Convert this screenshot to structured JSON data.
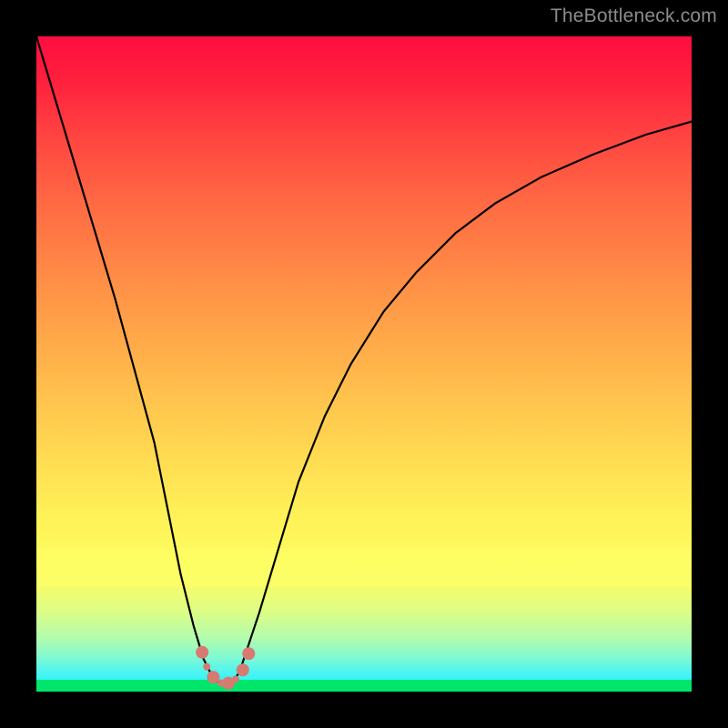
{
  "watermark": "TheBottleneck.com",
  "chart_data": {
    "type": "line",
    "title": "",
    "xlabel": "",
    "ylabel": "",
    "xlim": [
      0,
      100
    ],
    "ylim": [
      0,
      100
    ],
    "grid": false,
    "legend": false,
    "background_gradient": {
      "orientation": "vertical",
      "stops": [
        {
          "pos": 0,
          "color": "#ff0d3f"
        },
        {
          "pos": 50,
          "color": "#ffb84a"
        },
        {
          "pos": 80,
          "color": "#fcfc5f"
        },
        {
          "pos": 97,
          "color": "#4cf5f0"
        },
        {
          "pos": 100,
          "color": "#00e66a"
        }
      ]
    },
    "series": [
      {
        "name": "bottleneck-curve",
        "color": "#000000",
        "x": [
          0,
          3,
          6,
          9,
          12,
          15,
          18,
          20,
          22,
          24,
          25.5,
          27,
          28.5,
          30,
          31,
          32,
          34,
          37,
          40,
          44,
          48,
          53,
          58,
          64,
          70,
          77,
          85,
          93,
          100
        ],
        "y": [
          100,
          90,
          80,
          70,
          60,
          49,
          38,
          28,
          18,
          10,
          5,
          2,
          1,
          1.5,
          3,
          6,
          12,
          22,
          32,
          42,
          50,
          58,
          64,
          70,
          74.5,
          78.5,
          82,
          85,
          87
        ]
      }
    ],
    "markers": {
      "name": "highlight-dots",
      "shape": "circle",
      "color": "#d77a72",
      "radius_main": 7,
      "radius_small": 4,
      "points": [
        {
          "x": 25.3,
          "y": 6.0,
          "r": 7
        },
        {
          "x": 26.0,
          "y": 3.8,
          "r": 4
        },
        {
          "x": 27.0,
          "y": 2.2,
          "r": 7
        },
        {
          "x": 28.2,
          "y": 1.3,
          "r": 4
        },
        {
          "x": 29.3,
          "y": 1.3,
          "r": 7
        },
        {
          "x": 30.4,
          "y": 1.9,
          "r": 4
        },
        {
          "x": 31.5,
          "y": 3.3,
          "r": 7
        },
        {
          "x": 32.4,
          "y": 5.8,
          "r": 7
        }
      ]
    }
  }
}
